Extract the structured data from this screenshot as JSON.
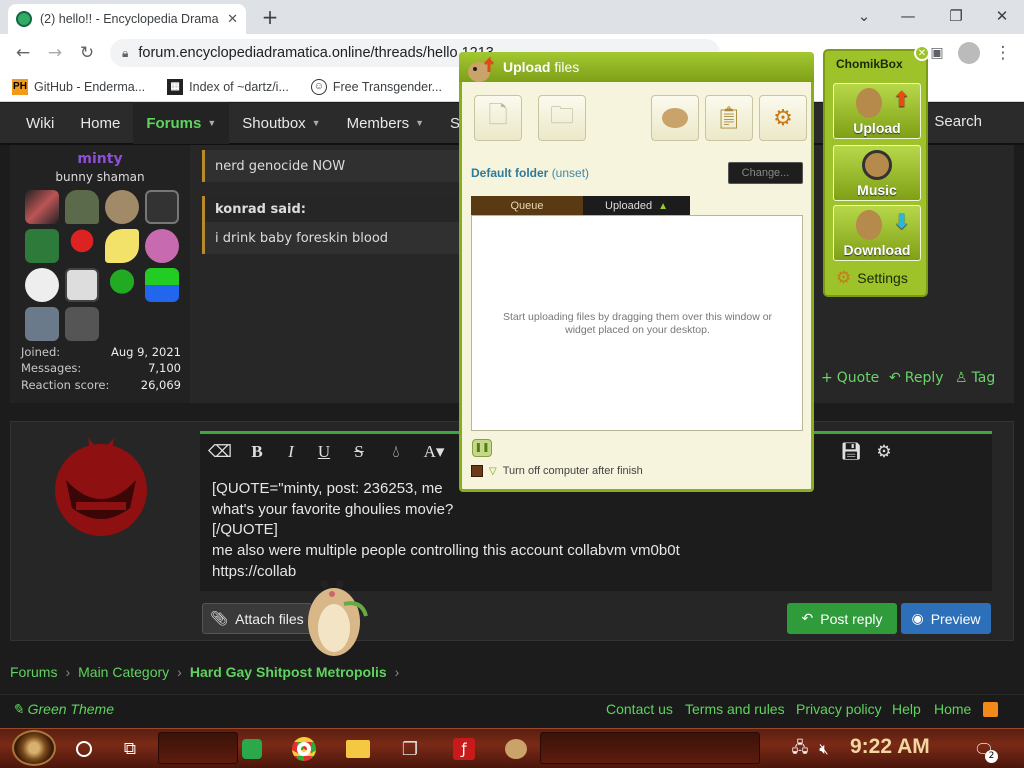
{
  "browser": {
    "tab_title": "(2) hello!! - Encyclopedia Drama",
    "url": "forum.encyclopediadramatica.online/threads/hello.1213",
    "bookmarks": [
      {
        "label": "GitHub - Enderma..."
      },
      {
        "label": "Index of ~dartz/i..."
      },
      {
        "label": "Free Transgender..."
      }
    ]
  },
  "forum_nav": {
    "items": [
      "Wiki",
      "Home",
      "Forums",
      "Shoutbox",
      "Members",
      "S"
    ],
    "active": "Forums",
    "search": "Search"
  },
  "post": {
    "username": "minty",
    "user_title": "bunny shaman",
    "stats": [
      {
        "label": "Joined:",
        "value": "Aug 9, 2021"
      },
      {
        "label": "Messages:",
        "value": "7,100"
      },
      {
        "label": "Reaction score:",
        "value": "26,069"
      }
    ],
    "quote1_text": "nerd genocide NOW",
    "quote2_author": "konrad said:",
    "quote2_text": "i drink baby foreskin blood",
    "actions": {
      "quote": "Quote",
      "reply": "Reply",
      "tag": "Tag"
    }
  },
  "editor": {
    "lines": [
      "[QUOTE=\"minty, post: 236253, me",
      "what's your favorite ghoulies movie?",
      "[/QUOTE]",
      "me also were multiple people controlling this account collabvm vm0b0t",
      "https://collab"
    ],
    "attach_label": "Attach files",
    "post_reply_label": "Post reply",
    "preview_label": "Preview"
  },
  "breadcrumbs": [
    "Forums",
    "Main Category",
    "Hard Gay Shitpost Metropolis"
  ],
  "footer": {
    "theme": "Green Theme",
    "links": [
      "Contact us",
      "Terms and rules",
      "Privacy policy",
      "Help",
      "Home"
    ]
  },
  "upload_window": {
    "title_bold": "Upload",
    "title_rest": "files",
    "default_folder_label": "Default folder",
    "default_folder_value": "(unset)",
    "change_label": "Change...",
    "tab_queue": "Queue",
    "tab_uploaded": "Uploaded",
    "empty_message": "Start uploading files by dragging them over this window or widget placed on your desktop.",
    "turn_off_label": "Turn off computer after finish"
  },
  "chomikbox": {
    "title": "ChomikBox",
    "buttons": [
      "Upload",
      "Music",
      "Download"
    ],
    "settings": "Settings"
  },
  "taskbar": {
    "time": "9:22 AM",
    "notification_count": "2"
  }
}
